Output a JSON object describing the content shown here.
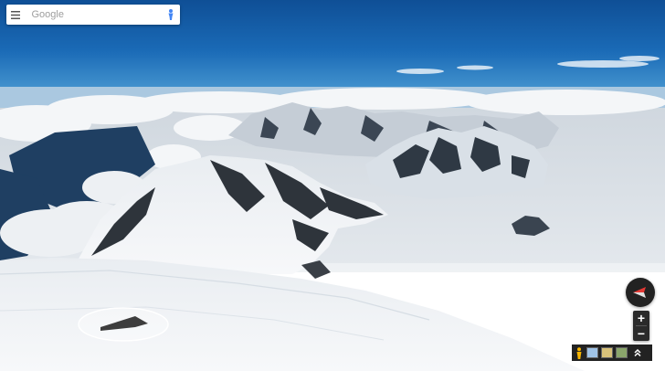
{
  "search": {
    "placeholder": "Google"
  },
  "icons": {
    "menu": "hamburger-menu-icon",
    "pegman": "pegman-icon",
    "compass": "compass-icon",
    "street_view_person": "pegman-icon",
    "expand": "chevron-up-icon"
  },
  "controls": {
    "zoom_in_label": "+",
    "zoom_out_label": "−"
  },
  "colors": {
    "accent": "#4285f4",
    "compass_red": "#e53935",
    "pegman_yellow": "#f7b500"
  }
}
